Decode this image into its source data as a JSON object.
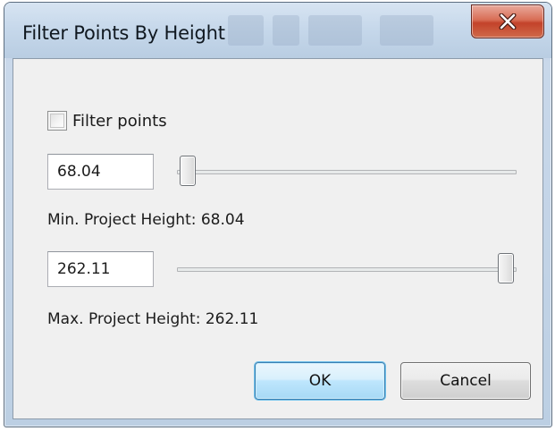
{
  "window": {
    "title": "Filter Points By Height",
    "close_icon": "close-icon"
  },
  "filter": {
    "checkbox_label": "Filter points",
    "checked": false
  },
  "min": {
    "value": "68.04",
    "label": "Min. Project Height: 68.04",
    "slider_level": 0.0
  },
  "max": {
    "value": "262.11",
    "label": "Max. Project Height: 262.11",
    "slider_level": 1.0
  },
  "buttons": {
    "ok_label": "OK",
    "cancel_label": "Cancel"
  },
  "colors": {
    "ok_border": "#3c7fb1",
    "close_red": "#c3422a"
  }
}
